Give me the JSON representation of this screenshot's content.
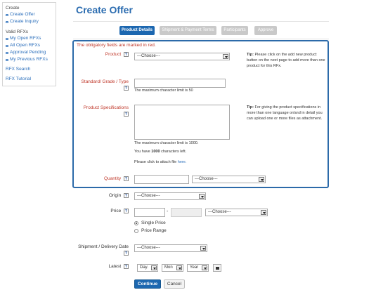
{
  "sidebar": {
    "create_heading": "Create",
    "create_items": [
      {
        "label": "Create Offer"
      },
      {
        "label": "Create Inquiry"
      }
    ],
    "rfx_heading": "Valid RFXs",
    "rfx_items": [
      {
        "label": "My Open RFXs"
      },
      {
        "label": "All Open RFXs"
      },
      {
        "label": "Approval Pending"
      },
      {
        "label": "My Previous RFXs"
      }
    ],
    "rfx_search": "RFX Search",
    "rfx_tutorial": "RFX Tutorial"
  },
  "page_title": "Create Offer",
  "tabs": [
    {
      "label": "Product Details",
      "active": true
    },
    {
      "label": "Shipment & Payment Terms",
      "active": false
    },
    {
      "label": "Participants",
      "active": false
    },
    {
      "label": "Approve",
      "active": false
    }
  ],
  "required_note": "The obligatory fields are marked in red.",
  "help_mark": "?",
  "form": {
    "product": {
      "label": "Product",
      "value": "---Choose---"
    },
    "product_tip_title": "Tip:",
    "product_tip": "Please click on the add new product button on the next page to add more than one product for this RFx.",
    "standard": {
      "label": "Standard/ Grade / Type",
      "value": "",
      "hint": "The maximum character limit is 50"
    },
    "specs": {
      "label": "Product Specifications",
      "value": "",
      "hint": "The maximum character limit is 1000."
    },
    "specs_tip_title": "Tip:",
    "specs_tip": "For giving the product specifications in more than one language or/and in detail you can upload one or more files as attachment.",
    "chars_left_prefix": "You have",
    "chars_left_count": "1000",
    "chars_left_suffix": "characters left.",
    "attach_prefix": "Please click to attach file",
    "attach_link": "here.",
    "quantity": {
      "label": "Quantity",
      "value": "",
      "unit": "---Choose---"
    },
    "origin": {
      "label": "Origin",
      "value": "---Choose---"
    },
    "price": {
      "label": "Price",
      "from": "",
      "separator": "-",
      "to": "",
      "currency": "---Choose---"
    },
    "price_options": [
      {
        "label": "Single Price",
        "selected": true
      },
      {
        "label": "Price Range",
        "selected": false
      }
    ],
    "shipment": {
      "label": "Shipment / Delivery Date",
      "value": "---Choose---"
    },
    "latest": {
      "label": "Latest",
      "day": "Day.",
      "month": "Mon",
      "year": "Year"
    }
  },
  "buttons": {
    "continue": "Continue",
    "cancel": "Cancel"
  }
}
